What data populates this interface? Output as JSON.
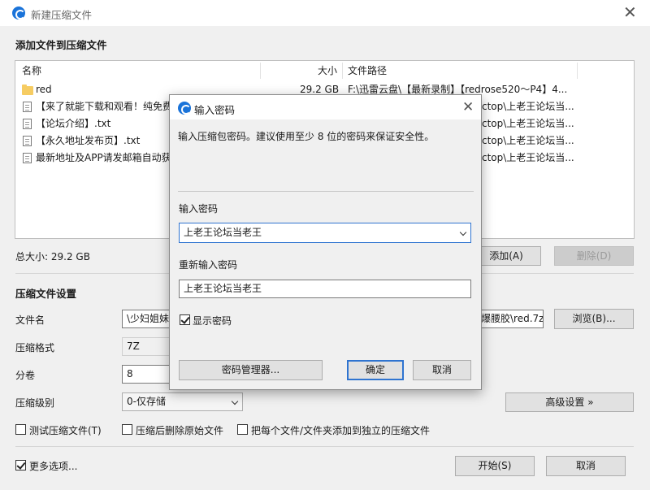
{
  "window": {
    "title": "新建压缩文件"
  },
  "header": {
    "add_files_title": "添加文件到压缩文件"
  },
  "filelist": {
    "columns": {
      "name": "名称",
      "size": "大小",
      "path": "文件路径"
    },
    "rows": [
      {
        "name": "red",
        "size": "29.2 GB",
        "path": "F:\\迅雷云盘\\【最新录制】【redrose520～P4】4...",
        "icon": "folder-icon"
      },
      {
        "name": "【来了就能下载和观看！纯免费",
        "size": "",
        "path": "ctop\\上老王论坛当...",
        "icon": "file-icon"
      },
      {
        "name": "【论坛介绍】.txt",
        "size": "",
        "path": "ctop\\上老王论坛当...",
        "icon": "file-icon"
      },
      {
        "name": "【永久地址发布页】.txt",
        "size": "",
        "path": "ctop\\上老王论坛当...",
        "icon": "file-icon"
      },
      {
        "name": "最新地址及APP请发邮箱自动获",
        "size": "",
        "path": "ctop\\上老王论坛当...",
        "icon": "file-icon"
      }
    ]
  },
  "summary": {
    "total_size": "总大小: 29.2 GB",
    "add_label": "添加(A)",
    "delete_label": "删除(D)"
  },
  "settings": {
    "title": "压缩文件设置",
    "filename_label": "文件名",
    "filename_value_left": "\\少妇姐妹",
    "filename_value_right": "爆腰胶\\red.7z",
    "browse_label": "浏览(B)...",
    "format_label": "压缩格式",
    "format_value": "7Z",
    "volume_label": "分卷",
    "volume_value": "8",
    "level_label": "压缩级别",
    "level_value": "0-仅存储",
    "advanced_label": "高级设置 »",
    "options": {
      "test": "测试压缩文件(T)",
      "delete_after": "压缩后删除原始文件",
      "separate": "把每个文件/文件夹添加到独立的压缩文件",
      "more": "更多选项..."
    },
    "more_checked": true
  },
  "footer": {
    "start_label": "开始(S)",
    "cancel_label": "取消"
  },
  "dialog": {
    "title": "输入密码",
    "description": "输入压缩包密码。建议使用至少 8 位的密码来保证安全性。",
    "password_label": "输入密码",
    "password_value": "上老王论坛当老王",
    "confirm_label": "重新输入密码",
    "confirm_value": "上老王论坛当老王",
    "show_password_label": "显示密码",
    "show_password_checked": true,
    "manager_label": "密码管理器...",
    "ok_label": "确定",
    "cancel_label": "取消"
  },
  "colors": {
    "accent": "#2f74d0",
    "app_icon": "#1a73d9",
    "folder": "#f6cc62"
  }
}
